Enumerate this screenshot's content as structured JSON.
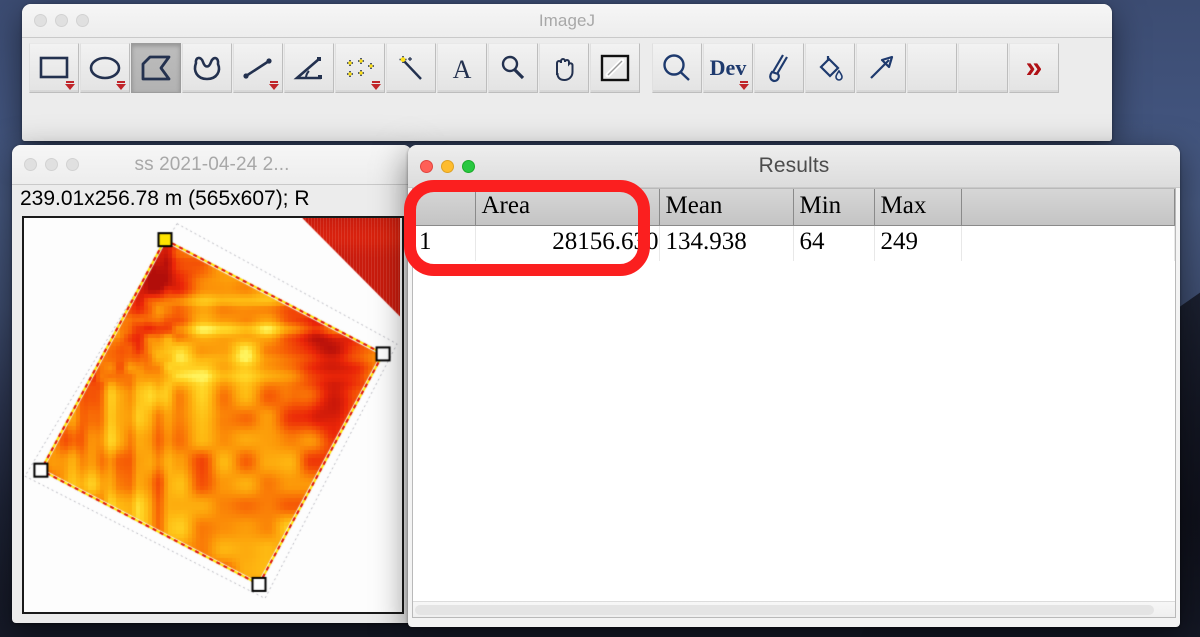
{
  "desktop": {
    "wallpaper_name": "night-mountain-wallpaper"
  },
  "imagej_window": {
    "title": "ImageJ",
    "traffic_lights": {
      "close": "close",
      "minimize": "minimize",
      "zoom": "zoom"
    },
    "toolbar": [
      {
        "name": "rectangle-tool",
        "icon": "rectangle-icon",
        "selected": false,
        "has_dropdown": true,
        "label": "Rectangle"
      },
      {
        "name": "oval-tool",
        "icon": "oval-icon",
        "selected": false,
        "has_dropdown": true,
        "label": "Oval"
      },
      {
        "name": "polygon-tool",
        "icon": "polygon-icon",
        "selected": true,
        "has_dropdown": false,
        "label": "Polygon"
      },
      {
        "name": "freehand-tool",
        "icon": "freehand-icon",
        "selected": false,
        "has_dropdown": false,
        "label": "Freehand"
      },
      {
        "name": "straight-line-tool",
        "icon": "line-icon",
        "selected": false,
        "has_dropdown": true,
        "label": "Straight Line"
      },
      {
        "name": "angle-tool",
        "icon": "angle-icon",
        "selected": false,
        "has_dropdown": false,
        "label": "Angle"
      },
      {
        "name": "point-tool",
        "icon": "multi-point-icon",
        "selected": false,
        "has_dropdown": true,
        "label": "Point"
      },
      {
        "name": "wand-tool",
        "icon": "magic-wand-icon",
        "selected": false,
        "has_dropdown": false,
        "label": "Wand (tracing)"
      },
      {
        "name": "text-tool",
        "icon": "text-a-icon",
        "selected": false,
        "has_dropdown": false,
        "label": "Text"
      },
      {
        "name": "magnifier-tool",
        "icon": "magnifier-icon",
        "selected": false,
        "has_dropdown": false,
        "label": "Magnifying Glass"
      },
      {
        "name": "hand-tool",
        "icon": "hand-icon",
        "selected": false,
        "has_dropdown": false,
        "label": "Scrolling"
      },
      {
        "name": "dropper-tool",
        "icon": "eyedropper-icon",
        "selected": false,
        "has_dropdown": false,
        "label": "Color Picker"
      },
      {
        "name": "zoom-tool",
        "icon": "search-icon",
        "selected": false,
        "has_dropdown": false,
        "label": "Zoom"
      },
      {
        "name": "dev-tool",
        "icon": "dev-text-icon",
        "selected": false,
        "has_dropdown": true,
        "label": "Dev"
      },
      {
        "name": "brush-tool",
        "icon": "paintbrush-icon",
        "selected": false,
        "has_dropdown": false,
        "label": "Brush"
      },
      {
        "name": "fill-tool",
        "icon": "paint-bucket-icon",
        "selected": false,
        "has_dropdown": false,
        "label": "Flood Fill"
      },
      {
        "name": "arrow-tool",
        "icon": "arrow-icon",
        "selected": false,
        "has_dropdown": false,
        "label": "Arrow"
      },
      {
        "name": "empty-slot-1",
        "icon": "",
        "selected": false,
        "has_dropdown": false,
        "label": ""
      },
      {
        "name": "empty-slot-2",
        "icon": "",
        "selected": false,
        "has_dropdown": false,
        "label": ""
      },
      {
        "name": "more-tools-button",
        "icon": "double-chevron-right-icon",
        "selected": false,
        "has_dropdown": false,
        "label": "More Tools"
      }
    ],
    "dev_label": "Dev",
    "more_label": "»"
  },
  "image_window": {
    "title": "ss 2021-04-24 2...",
    "info_line": "239.01x256.78 m (565x607); R",
    "roi": {
      "type": "polygon",
      "handle_count": 4,
      "active_handle": "top-left"
    }
  },
  "results_window": {
    "title": "Results",
    "columns": [
      "",
      "Area",
      "Mean",
      "Min",
      "Max",
      ""
    ],
    "rows": [
      {
        "index": "1",
        "area": "28156.630",
        "mean": "134.938",
        "min": "64",
        "max": "249",
        "extra": ""
      }
    ]
  },
  "annotation": {
    "shape": "rounded-rectangle-highlight",
    "color": "#fb1f1f",
    "target": "Area column value 28156.630"
  }
}
